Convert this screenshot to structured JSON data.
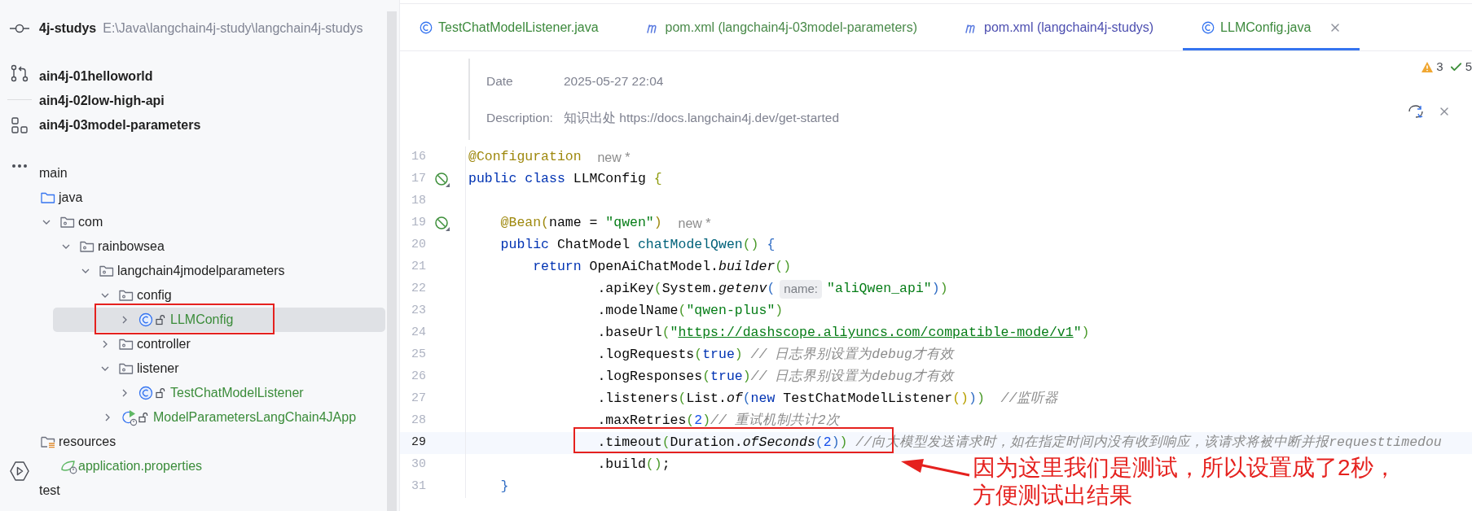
{
  "project_tree": [
    {
      "label": "4j-studys",
      "path": "E:\\Java\\langchain4j-study\\langchain4j-studys",
      "kind": "project",
      "selected": false,
      "added": false
    },
    {
      "label": "ain4j-01helloworld",
      "kind": "module",
      "selected": false,
      "added": false
    },
    {
      "label": "ain4j-02low-high-api",
      "kind": "module",
      "selected": false,
      "added": false
    },
    {
      "label": "ain4j-03model-parameters",
      "kind": "module",
      "selected": false,
      "added": false
    },
    {
      "label": "main",
      "kind": "plain",
      "selected": false,
      "added": false,
      "children": [
        {
          "label": "java",
          "kind": "folder",
          "selected": false,
          "added": false,
          "children": [
            {
              "label": "com",
              "kind": "package",
              "expanded": true,
              "selected": false,
              "added": false,
              "children": [
                {
                  "label": "rainbowsea",
                  "kind": "package",
                  "expanded": true,
                  "selected": false,
                  "added": false,
                  "children": [
                    {
                      "label": "langchain4jmodelparameters",
                      "kind": "package",
                      "expanded": true,
                      "selected": false,
                      "added": false,
                      "children": [
                        {
                          "label": "config",
                          "kind": "package",
                          "expanded": true,
                          "selected": false,
                          "added": false,
                          "children": [
                            {
                              "label": "LLMConfig",
                              "kind": "class",
                              "expanded": false,
                              "selected": true,
                              "added": true
                            }
                          ]
                        },
                        {
                          "label": "controller",
                          "kind": "package",
                          "expanded": false,
                          "selected": false,
                          "added": false
                        },
                        {
                          "label": "listener",
                          "kind": "package",
                          "expanded": true,
                          "selected": false,
                          "added": false,
                          "children": [
                            {
                              "label": "TestChatModelListener",
                              "kind": "class",
                              "expanded": false,
                              "selected": false,
                              "added": true
                            }
                          ]
                        },
                        {
                          "label": "ModelParametersLangChain4JApp",
                          "kind": "app",
                          "expanded": false,
                          "selected": false,
                          "added": true
                        }
                      ]
                    }
                  ]
                }
              ]
            }
          ]
        },
        {
          "label": "resources",
          "kind": "resources",
          "selected": false,
          "added": false,
          "children": [
            {
              "label": "application.properties",
              "kind": "properties",
              "selected": false,
              "added": true
            }
          ]
        }
      ]
    },
    {
      "label": "test",
      "kind": "plain",
      "selected": false,
      "added": false
    }
  ],
  "tabs": [
    {
      "label": "TestChatModelListener.java",
      "kind": "class",
      "color": "#3d8a3d",
      "selected": false
    },
    {
      "label": "pom.xml (langchain4j-03model-parameters)",
      "kind": "maven",
      "color": "#4a8a4a",
      "selected": false
    },
    {
      "label": "pom.xml (langchain4j-studys)",
      "kind": "maven",
      "color": "#4d4fb0",
      "selected": false
    },
    {
      "label": "LLMConfig.java",
      "kind": "class",
      "color": "#3d8a3d",
      "selected": true
    }
  ],
  "doc": [
    {
      "label": "Date",
      "value": "2025-05-27 22:04"
    },
    {
      "label": "Description:",
      "value": "知识出处 https://docs.langchain4j.dev/get-started"
    }
  ],
  "inspections": {
    "warnings": "3",
    "passed": "5"
  },
  "code_lines": [
    {
      "number": "16",
      "current": false,
      "bean": false,
      "tokens": [
        {
          "text": "@Configuration",
          "kind": "annotation"
        },
        {
          "text": "  new *",
          "kind": "hint"
        }
      ]
    },
    {
      "number": "17",
      "current": false,
      "bean": true,
      "tokens": [
        {
          "text": "public class",
          "kind": "keyword"
        },
        {
          "text": " LLMConfig",
          "kind": "plain"
        },
        {
          "text": " {",
          "kind": "bracket",
          "color": "#8f9c10"
        }
      ]
    },
    {
      "number": "18",
      "current": false,
      "bean": false
    },
    {
      "number": "19",
      "current": false,
      "bean": true,
      "tokens": [
        {
          "text": "    @Bean(",
          "kind": "annotation"
        },
        {
          "text": "name =",
          "kind": "plain"
        },
        {
          "text": " \"qwen\"",
          "kind": "string"
        },
        {
          "text": ")",
          "kind": "annotation"
        },
        {
          "text": "  new *",
          "kind": "hint"
        }
      ]
    },
    {
      "number": "20",
      "current": false,
      "bean": false,
      "tokens": [
        {
          "text": "    public",
          "kind": "keyword"
        },
        {
          "text": " ChatModel",
          "kind": "plain"
        },
        {
          "text": " chatModelQwen",
          "kind": "method"
        },
        {
          "text": "()",
          "kind": "bracket",
          "color": "#4a9a2a"
        },
        {
          "text": " {",
          "kind": "bracket",
          "color": "#2f6cc4"
        }
      ]
    },
    {
      "number": "21",
      "current": false,
      "bean": false,
      "tokens": [
        {
          "text": "        return",
          "kind": "keyword"
        },
        {
          "text": " OpenAiChatModel.",
          "kind": "plain"
        },
        {
          "text": "builder",
          "kind": "static"
        },
        {
          "text": "()",
          "kind": "bracket",
          "color": "#4a9a2a"
        }
      ]
    },
    {
      "number": "22",
      "current": false,
      "bean": false,
      "tokens": [
        {
          "text": "                .apiKey",
          "kind": "plain"
        },
        {
          "text": "(",
          "kind": "bracket",
          "color": "#4a9a2a"
        },
        {
          "text": "System.",
          "kind": "plain"
        },
        {
          "text": "getenv",
          "kind": "static"
        },
        {
          "text": "(",
          "kind": "bracket",
          "color": "#2f6cc4"
        },
        {
          "text": "name:",
          "kind": "inlay"
        },
        {
          "text": "\"aliQwen_api\"",
          "kind": "string"
        },
        {
          "text": ")",
          "kind": "bracket",
          "color": "#2f6cc4"
        },
        {
          "text": ")",
          "kind": "bracket",
          "color": "#4a9a2a"
        }
      ]
    },
    {
      "number": "23",
      "current": false,
      "bean": false,
      "tokens": [
        {
          "text": "                .modelName",
          "kind": "plain"
        },
        {
          "text": "(",
          "kind": "bracket",
          "color": "#4a9a2a"
        },
        {
          "text": "\"qwen-plus\"",
          "kind": "string"
        },
        {
          "text": ")",
          "kind": "bracket",
          "color": "#4a9a2a"
        }
      ]
    },
    {
      "number": "24",
      "current": false,
      "bean": false,
      "tokens": [
        {
          "text": "                .baseUrl",
          "kind": "plain"
        },
        {
          "text": "(",
          "kind": "bracket",
          "color": "#4a9a2a"
        },
        {
          "text": "\"",
          "kind": "string"
        },
        {
          "text": "https://dashscope.aliyuncs.com/compatible-mode/v1",
          "kind": "link"
        },
        {
          "text": "\"",
          "kind": "string"
        },
        {
          "text": ")",
          "kind": "bracket",
          "color": "#4a9a2a"
        }
      ]
    },
    {
      "number": "25",
      "current": false,
      "bean": false,
      "tokens": [
        {
          "text": "                .logRequests",
          "kind": "plain"
        },
        {
          "text": "(",
          "kind": "bracket",
          "color": "#4a9a2a"
        },
        {
          "text": "true",
          "kind": "keyword"
        },
        {
          "text": ")",
          "kind": "bracket",
          "color": "#4a9a2a"
        },
        {
          "text": " // 日志界别设置为debug才有效",
          "kind": "comment"
        }
      ]
    },
    {
      "number": "26",
      "current": false,
      "bean": false,
      "tokens": [
        {
          "text": "                .logResponses",
          "kind": "plain"
        },
        {
          "text": "(",
          "kind": "bracket",
          "color": "#4a9a2a"
        },
        {
          "text": "true",
          "kind": "keyword"
        },
        {
          "text": ")",
          "kind": "bracket",
          "color": "#4a9a2a"
        },
        {
          "text": "// 日志界别设置为debug才有效",
          "kind": "comment"
        }
      ]
    },
    {
      "number": "27",
      "current": false,
      "bean": false,
      "tokens": [
        {
          "text": "                .listeners",
          "kind": "plain"
        },
        {
          "text": "(",
          "kind": "bracket",
          "color": "#4a9a2a"
        },
        {
          "text": "List.",
          "kind": "plain"
        },
        {
          "text": "of",
          "kind": "static"
        },
        {
          "text": "(",
          "kind": "bracket",
          "color": "#2f6cc4"
        },
        {
          "text": "new",
          "kind": "keyword"
        },
        {
          "text": " TestChatModelListener",
          "kind": "plain"
        },
        {
          "text": "()",
          "kind": "bracket",
          "color": "#b8a000"
        },
        {
          "text": ")",
          "kind": "bracket",
          "color": "#2f6cc4"
        },
        {
          "text": ")",
          "kind": "bracket",
          "color": "#4a9a2a"
        },
        {
          "text": "  //监听器",
          "kind": "comment"
        }
      ]
    },
    {
      "number": "28",
      "current": false,
      "bean": false,
      "tokens": [
        {
          "text": "                .maxRetries",
          "kind": "plain"
        },
        {
          "text": "(",
          "kind": "bracket",
          "color": "#4a9a2a"
        },
        {
          "text": "2",
          "kind": "number"
        },
        {
          "text": ")",
          "kind": "bracket",
          "color": "#4a9a2a"
        },
        {
          "text": "// 重试机制共计2次",
          "kind": "comment"
        }
      ]
    },
    {
      "number": "29",
      "current": true,
      "bean": false,
      "tokens": [
        {
          "text": "                .timeout",
          "kind": "plain"
        },
        {
          "text": "(",
          "kind": "bracket",
          "color": "#4a9a2a"
        },
        {
          "text": "Duration.",
          "kind": "plain"
        },
        {
          "text": "ofSeconds",
          "kind": "static"
        },
        {
          "text": "(",
          "kind": "bracket",
          "color": "#2f6cc4"
        },
        {
          "text": "2",
          "kind": "number"
        },
        {
          "text": ")",
          "kind": "bracket",
          "color": "#2f6cc4"
        },
        {
          "text": ")",
          "kind": "bracket",
          "color": "#4a9a2a"
        },
        {
          "text": " //向大模型发送请求时，如在指定时间内没有收到响应，该请求将被中断并报requesttimedou",
          "kind": "comment"
        }
      ]
    },
    {
      "number": "30",
      "current": false,
      "bean": false,
      "tokens": [
        {
          "text": "                .build",
          "kind": "plain"
        },
        {
          "text": "()",
          "kind": "bracket",
          "color": "#4a9a2a"
        },
        {
          "text": ";",
          "kind": "plain"
        }
      ]
    },
    {
      "number": "31",
      "current": false,
      "bean": false,
      "tokens": [
        {
          "text": "    }",
          "kind": "bracket",
          "color": "#2f6cc4"
        }
      ]
    }
  ],
  "note": [
    "因为这里我们是测试，所以设置成了2秒，",
    "方便测试出结果"
  ]
}
